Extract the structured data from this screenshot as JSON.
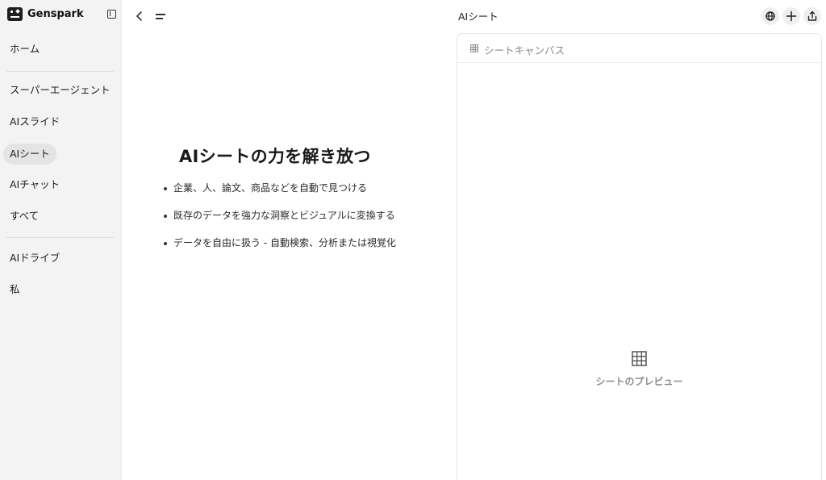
{
  "brand": {
    "name": "Genspark"
  },
  "sidebar": {
    "items": [
      {
        "label": "ホーム"
      },
      {
        "label": "スーパーエージェント"
      },
      {
        "label": "AIスライド"
      },
      {
        "label": "AIシート"
      },
      {
        "label": "AIチャット"
      },
      {
        "label": "すべて"
      },
      {
        "label": "AIドライブ"
      },
      {
        "label": "私"
      }
    ],
    "active": "AIシート"
  },
  "topbar": {
    "title": "AIシート"
  },
  "hero": {
    "title": "AIシートの力を解き放つ",
    "bullets": [
      "企業、人、論文、商品などを自動で見つける",
      "既存のデータを強力な洞察とビジュアルに変換する",
      "データを自由に扱う - 自動検索、分析または視覚化"
    ]
  },
  "canvas": {
    "header_label": "シートキャンバス",
    "preview_label": "シートのプレビュー"
  },
  "icons": {
    "back": "chevron-left-icon",
    "menu": "menu-icon",
    "globe": "globe-icon",
    "add": "plus-icon",
    "share": "share-icon",
    "grid": "grid-icon"
  }
}
